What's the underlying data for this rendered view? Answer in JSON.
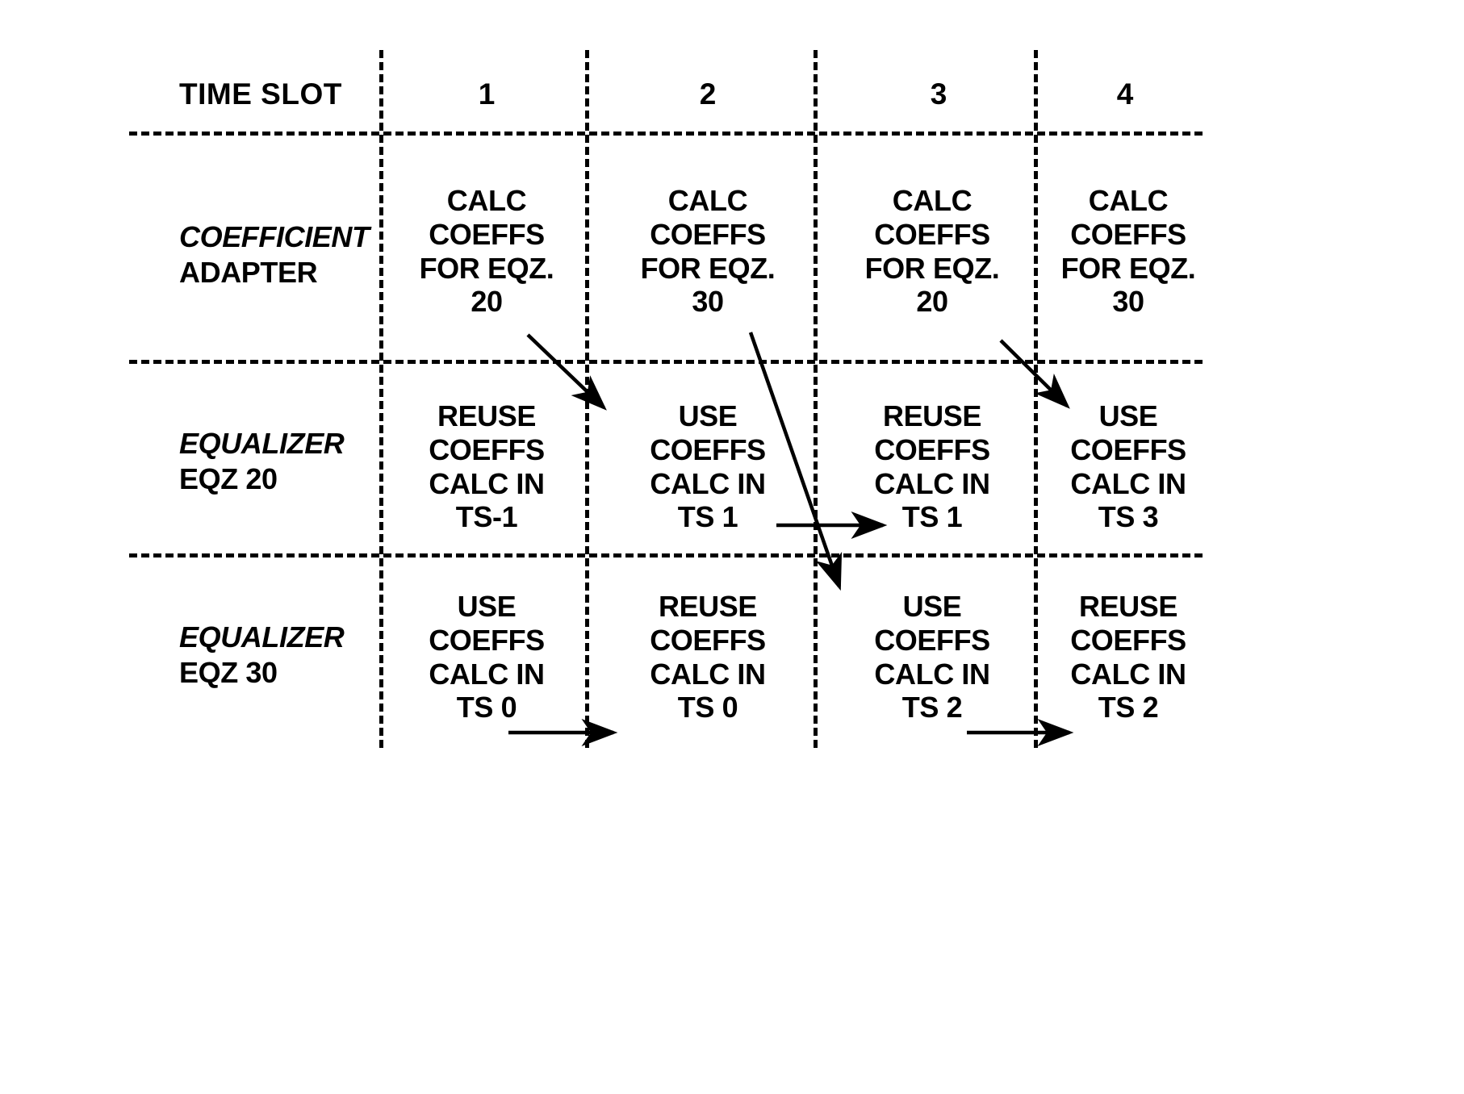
{
  "figure": {
    "header": {
      "row_label": "TIME SLOT",
      "columns": [
        "1",
        "2",
        "3",
        "4"
      ]
    },
    "rows": [
      {
        "label_italic": "COEFFICIENT",
        "label_upright": "ADAPTER",
        "cells": [
          "CALC\nCOEFFS\nFOR EQZ.\n20",
          "CALC\nCOEFFS\nFOR EQZ.\n30",
          "CALC\nCOEFFS\nFOR EQZ.\n20",
          "CALC\nCOEFFS\nFOR EQZ.\n30"
        ]
      },
      {
        "label_italic": "EQUALIZER",
        "label_upright": "EQZ 20",
        "cells": [
          "REUSE\nCOEFFS\nCALC IN\nTS-1",
          "USE\nCOEFFS\nCALC IN\nTS 1",
          "REUSE\nCOEFFS\nCALC IN\nTS 1",
          "USE\nCOEFFS\nCALC IN\nTS 3"
        ]
      },
      {
        "label_italic": "EQUALIZER",
        "label_upright": "EQZ 30",
        "cells": [
          "USE\nCOEFFS\nCALC IN\nTS 0",
          "REUSE\nCOEFFS\nCALC IN\nTS 0",
          "USE\nCOEFFS\nCALC IN\nTS 2",
          "REUSE\nCOEFFS\nCALC IN\nTS 2"
        ]
      }
    ],
    "colors": {
      "ink": "#000000",
      "paper": "#ffffff"
    }
  }
}
